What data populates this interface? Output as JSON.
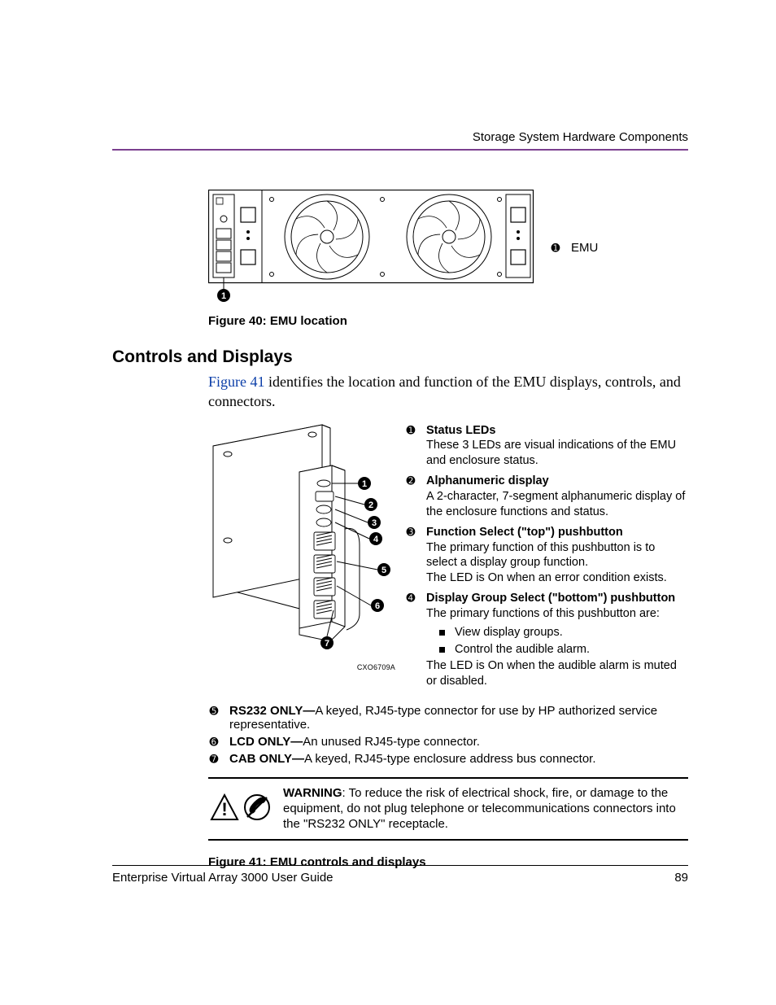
{
  "header": {
    "section": "Storage System Hardware Components"
  },
  "fig40": {
    "key_num": "➊",
    "key_label": "EMU",
    "callout_num": "1",
    "caption": "Figure 40:  EMU location"
  },
  "h2": "Controls and Displays",
  "intro": {
    "link": "Figure 41",
    "rest": " identifies the location and function of the EMU displays, controls, and connectors."
  },
  "fig41": {
    "diagram_code": "CXO6709A",
    "legend": [
      {
        "num": "➊",
        "title": "Status LEDs",
        "desc": "These 3 LEDs are visual indications of the EMU and enclosure status."
      },
      {
        "num": "➋",
        "title": "Alphanumeric display",
        "desc": "A 2-character, 7-segment alphanumeric display of the enclosure functions and status."
      },
      {
        "num": "➌",
        "title": "Function Select (\"top\") pushbutton",
        "desc": "The primary function of this pushbutton is to select a display group function.",
        "desc2": "The LED is On when an error condition exists."
      },
      {
        "num": "➍",
        "title": "Display Group Select (\"bottom\") pushbutton",
        "desc": "The primary functions of this pushbutton are:",
        "bullets": [
          "View display groups.",
          "Control the audible alarm."
        ],
        "desc2": "The LED is On when the audible alarm is muted or disabled."
      }
    ],
    "lower": [
      {
        "num": "➎",
        "title": "RS232 ONLY—",
        "desc": "A keyed, RJ45-type connector for use by HP authorized service representative."
      },
      {
        "num": "➏",
        "title": "LCD ONLY—",
        "desc": "An unused RJ45-type connector."
      },
      {
        "num": "➐",
        "title": "CAB ONLY—",
        "desc": "A keyed, RJ45-type enclosure address bus connector."
      }
    ],
    "warning_label": "WARNING",
    "warning_text": ": To reduce the risk of electrical shock, fire, or damage to the equipment, do not plug telephone or telecommunications connectors into the \"RS232 ONLY\" receptacle.",
    "caption": "Figure 41:  EMU controls and displays"
  },
  "footer": {
    "title": "Enterprise Virtual Array 3000 User Guide",
    "page": "89"
  }
}
